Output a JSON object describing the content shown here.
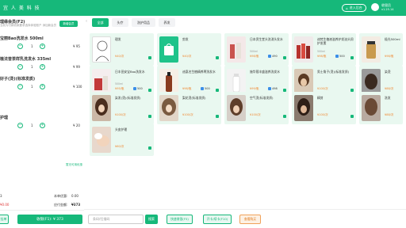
{
  "app": {
    "logo_text": "宜 人 美 科 技",
    "enter_label": "进入后台",
    "user_name": "收银员",
    "version": "v1.25.14"
  },
  "order": {
    "card_title": "理缘会员(F2)",
    "card_sub": "当前为付款收款要求选择体验账户 添加新会员",
    "change_label": "新增会员",
    "items": [
      {
        "name": "宝丽Bao洗发水 500ml",
        "qty": "1",
        "price": "¥ 95"
      },
      {
        "name": "植法普茶样乳洗发水 335ml",
        "qty": "1",
        "price": "¥ 99"
      },
      {
        "name": "好子(烫)(标准发质)",
        "qty": "1",
        "price": "¥ 100"
      },
      {
        "name": "护理",
        "qty": "1",
        "price": "¥ 20"
      }
    ],
    "coupon_link": "暂无可用优惠",
    "total_qty": "3",
    "discount_label": "本单优惠:",
    "discount_val": "0.00",
    "red_price": "¥0.00",
    "sum_label": "应付金额:",
    "sum_val": "¥373",
    "hang_label": "挂单",
    "pay_label": "收银(F1): ¥ 373"
  },
  "tabs": [
    "全部",
    "头疗",
    "洗护用品",
    "养发"
  ],
  "products": [
    {
      "name": "理发",
      "spec": "",
      "price": "¥40/次",
      "stock": "",
      "img": "person"
    },
    {
      "name": "剪发",
      "spec": "",
      "price": "¥40/次",
      "stock": "",
      "img": "bag"
    },
    {
      "name": "日本资生堂头洗消头发水",
      "spec": "500ml",
      "price": "¥98/瓶",
      "stock": "490",
      "img": "bottles"
    },
    {
      "name": "迪梵生植液滋养护发油头润护发素",
      "spec": "500ml",
      "price": "¥98/瓶",
      "stock": "500",
      "img": "bottles2"
    },
    {
      "name": "极光500ml",
      "spec": "",
      "price": "¥98/瓶",
      "stock": "",
      "img": "jar"
    },
    {
      "name": "日丰田安宝Bao洗发水",
      "spec": "500ml",
      "price": "¥95/瓶",
      "stock": "500",
      "img": "gift"
    },
    {
      "name": "迪惠名生植精养菁洗发水",
      "spec": "",
      "price": "¥98/瓶",
      "stock": "500",
      "img": "amber"
    },
    {
      "name": "施华蔻丰盛滋养洗发水",
      "spec": "",
      "price": "¥99/瓶",
      "stock": "498",
      "img": "white"
    },
    {
      "name": "男士角子(烫)(标准发质)",
      "spec": "",
      "price": "¥100/次",
      "stock": "",
      "img": "hair1"
    },
    {
      "name": "染烫",
      "spec": "",
      "price": "¥88/次",
      "stock": "",
      "img": "hair2"
    },
    {
      "name": "染发(烫)(标准发质)",
      "spec": "",
      "price": "¥100/次",
      "stock": "",
      "img": "hair3"
    },
    {
      "name": "梨花烫(标准发质)",
      "spec": "",
      "price": "¥100/次",
      "stock": "",
      "img": "hair4"
    },
    {
      "name": "空气烫(标准发质)",
      "spec": "",
      "price": "¥100/次",
      "stock": "",
      "img": "hair5"
    },
    {
      "name": "精剪",
      "spec": "",
      "price": "¥100/次",
      "stock": "",
      "img": "hair6"
    },
    {
      "name": "洗发",
      "spec": "",
      "price": "¥88/次",
      "stock": "",
      "img": "hair7"
    },
    {
      "name": "头皮护理",
      "spec": "",
      "price": "¥60/次",
      "stock": "",
      "img": "spa"
    }
  ],
  "bottom": {
    "search_placeholder": "条码/扫描码",
    "search_label": "搜索",
    "btn1": "快速收银(F5)",
    "btn2": "开卡/续卡(F10)",
    "btn3": "查看购买"
  },
  "colors": {
    "accent": "#16b87a",
    "card_bg": "#e9f8f0",
    "price": "#f0852d"
  }
}
